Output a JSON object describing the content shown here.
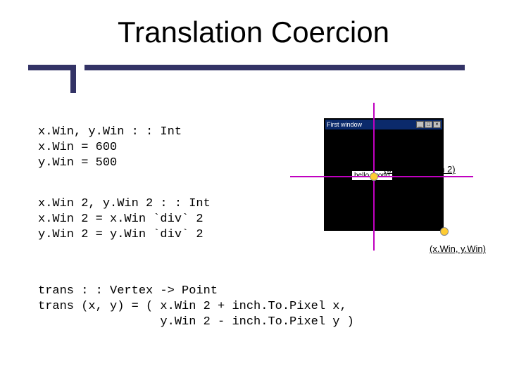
{
  "title": "Translation Coercion",
  "code_block_1": "x.Win, y.Win : : Int\nx.Win = 600\ny.Win = 500",
  "code_block_2": "x.Win 2, y.Win 2 : : Int\nx.Win 2 = x.Win `div` 2\ny.Win 2 = y.Win `div` 2",
  "code_block_3": "trans : : Vertex -> Point\ntrans (x, y) = ( x.Win 2 + inch.To.Pixel x,\n                 y.Win 2 - inch.To.Pixel y )",
  "figure": {
    "window_title": "First window",
    "hello_text": "hello, world",
    "btn_min": "_",
    "btn_max": "□",
    "btn_close": "×",
    "label_center": "(x.Win 2, y.Win 2)",
    "label_corner": "(x.Win, y.Win)"
  }
}
